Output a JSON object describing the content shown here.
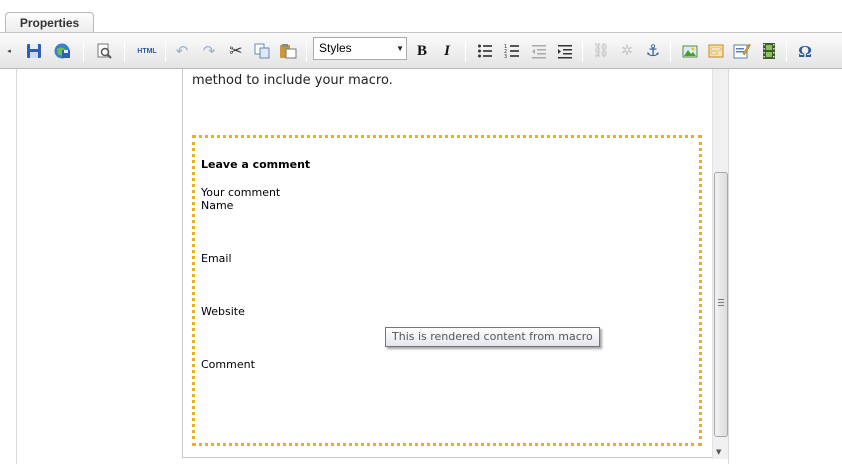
{
  "tabs": [
    {
      "label": "Properties"
    }
  ],
  "toolbar": {
    "html_label": "HTML",
    "styles_value": "Styles",
    "omega": "Ω"
  },
  "content": {
    "intro_text": "method to include your macro."
  },
  "macro": {
    "title": "Leave a comment",
    "your_comment": "Your comment",
    "name_label": "Name",
    "email_label": "Email",
    "website_label": "Website",
    "comment_label": "Comment",
    "tooltip": "This is rendered content from macro"
  },
  "colors": {
    "macro_border": "#e8b01c",
    "save_blue": "#2f5fb3"
  }
}
